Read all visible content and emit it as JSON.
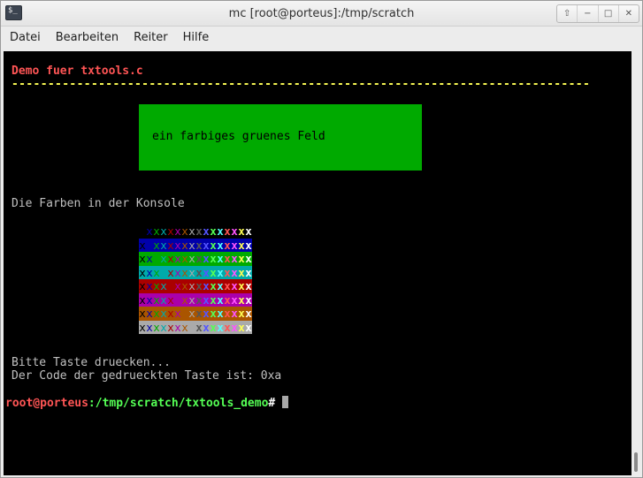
{
  "window": {
    "title": "mc [root@porteus]:/tmp/scratch",
    "app_icon_glyph": "$_",
    "buttons": {
      "up_glyph": "⇧",
      "minimize_glyph": "−",
      "maximize_glyph": "□",
      "close_glyph": "✕"
    }
  },
  "menu": {
    "items": [
      "Datei",
      "Bearbeiten",
      "Reiter",
      "Hilfe"
    ]
  },
  "terminal": {
    "heading": "Demo fuer txtools.c",
    "separator": "--------------------------------------------------------------------------------",
    "green_field_text": "ein farbiges gruenes Feld",
    "colors_label": "Die Farben in der Konsole",
    "message_press_key": "Bitte Taste druecken...",
    "message_key_code": "Der Code der gedrueckten Taste ist: 0xa",
    "prompt": {
      "user_host": "root@porteus",
      "path": ":/tmp/scratch/txtools_demo",
      "symbol": "#"
    },
    "grid_char": "x",
    "grid_backgrounds": [
      "#000000",
      "#0000aa",
      "#00aa00",
      "#00aaaa",
      "#aa0000",
      "#aa00aa",
      "#aa5500",
      "#aaaaaa"
    ],
    "grid_foregrounds": [
      "#000000",
      "#0000aa",
      "#00aa00",
      "#00aaaa",
      "#aa0000",
      "#aa00aa",
      "#aa5500",
      "#aaaaaa",
      "#555555",
      "#5555ff",
      "#55ff55",
      "#55ffff",
      "#ff5555",
      "#ff55ff",
      "#ffff55",
      "#ffffff"
    ]
  }
}
